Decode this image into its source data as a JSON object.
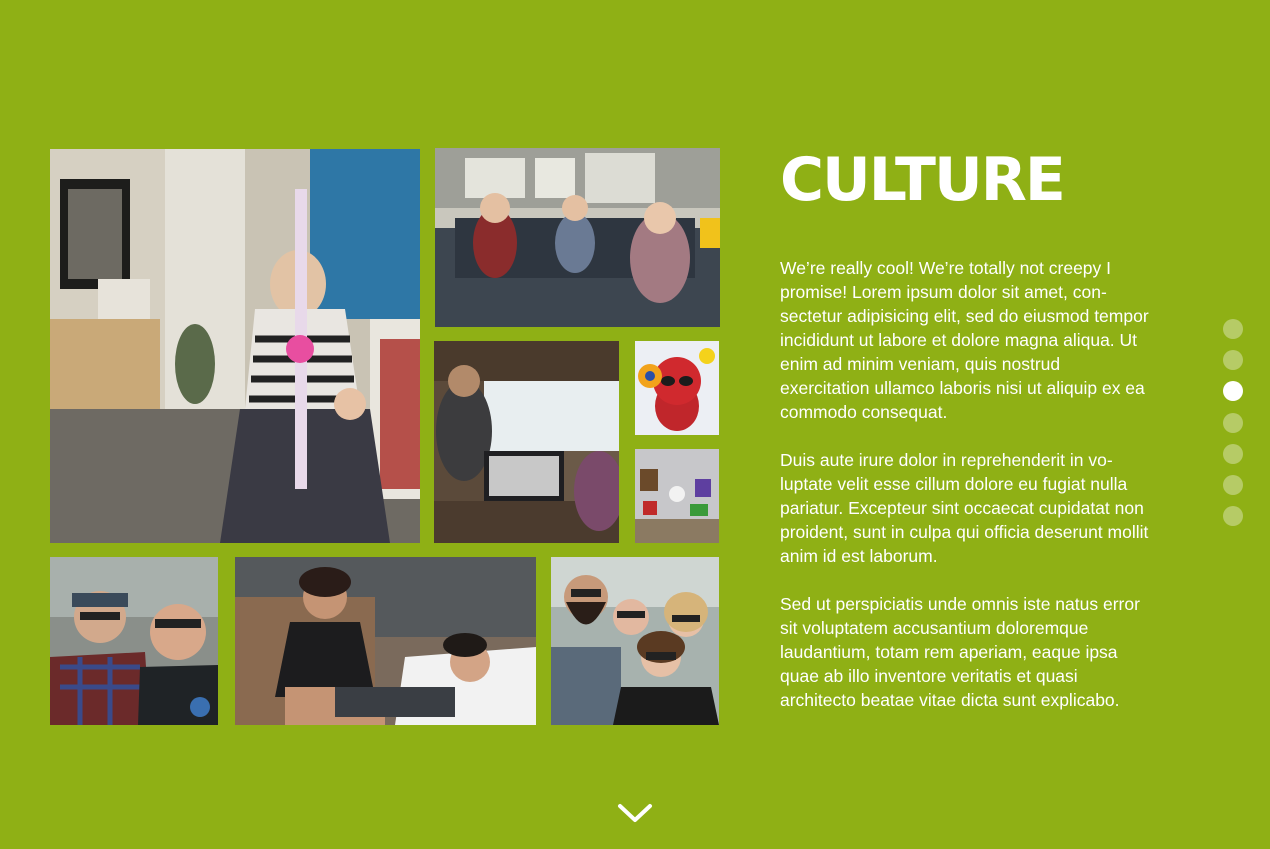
{
  "section": {
    "title": "CULTURE",
    "paragraphs": [
      "We’re really cool! We’re totally not creepy I promise! Lorem ipsum dolor sit amet, con­sectetur adipisicing elit, sed do eiusmod tempor incididunt ut labore et dolore magna aliqua. Ut enim ad minim veniam, quis nostrud exercitation ullamco laboris nisi ut aliquip ex ea commodo consequat.",
      "Duis aute irure dolor in reprehenderit in vo­luptate velit esse cillum dolore eu fugiat nulla pariatur. Excepteur sint occaecat cupi­datat non proident, sunt in culpa qui officia deserunt mollit anim id est laborum.",
      "Sed ut perspiciatis unde omnis iste natus error sit voluptatem accusantium dolorem­que laudantium, totam rem aperiam, eaque ipsa quae ab illo inventore veritatis et quasi architecto beatae vitae dicta sunt explicabo."
    ]
  },
  "nav_dots": {
    "count": 7,
    "active_index": 2
  },
  "colors": {
    "background": "#8fb015",
    "text": "#ffffff"
  },
  "icons": {
    "scroll_down": "chevron-down-icon"
  }
}
